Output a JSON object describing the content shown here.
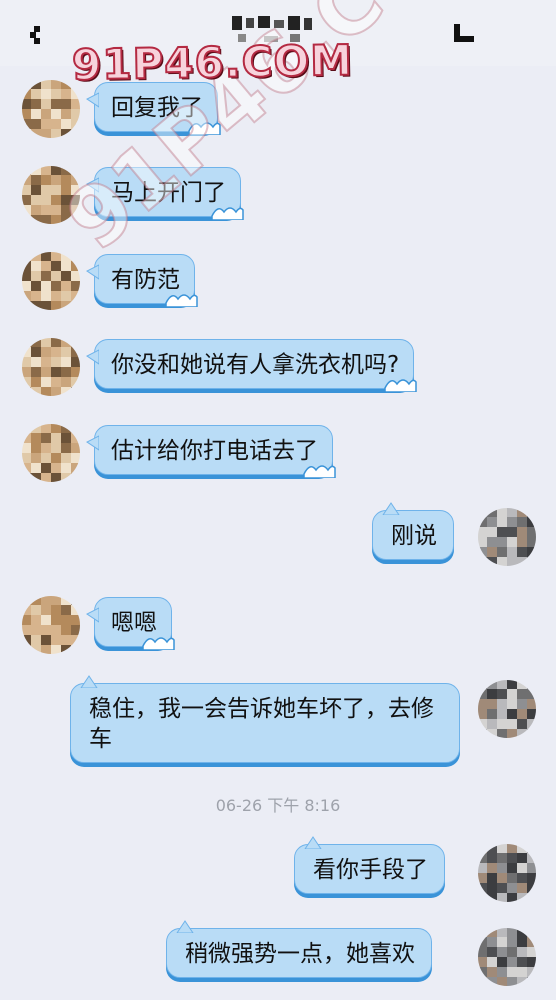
{
  "header": {
    "back_icon": "chevron-left-icon",
    "title": "",
    "profile_icon": "profile-icon"
  },
  "watermark": {
    "text": "91P46.COM"
  },
  "messages": [
    {
      "side": "left",
      "text": "回复我了"
    },
    {
      "side": "left",
      "text": "马上开门了"
    },
    {
      "side": "left",
      "text": "有防范"
    },
    {
      "side": "left",
      "text": "你没和她说有人拿洗衣机吗?"
    },
    {
      "side": "left",
      "text": "估计给你打电话去了"
    },
    {
      "side": "right",
      "text": "刚说"
    },
    {
      "side": "left",
      "text": "嗯嗯"
    },
    {
      "side": "right",
      "text": "稳住，我一会告诉她车坏了，去修车"
    },
    {
      "side": "right",
      "text": "看你手段了"
    },
    {
      "side": "right",
      "text": "稍微强势一点，她喜欢"
    }
  ],
  "timestamp": "06-26 下午 8:16",
  "colors": {
    "background": "#ebedf5",
    "bubble_fill": "#b9dcf6",
    "bubble_border": "#6fb3ea",
    "bubble_shadow": "#3a93d8"
  }
}
